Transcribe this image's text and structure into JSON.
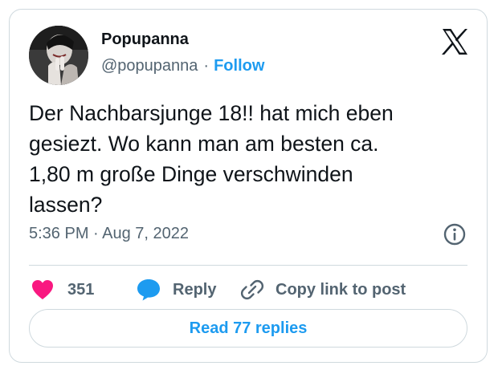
{
  "author": {
    "display_name": "Popupanna",
    "handle": "@popupanna",
    "separator": "·",
    "follow_label": "Follow"
  },
  "tweet": {
    "text": "Der Nachbarsjunge 18!! hat mich eben\ngesiezt. Wo kann man am besten ca.\n1,80 m große Dinge verschwinden\nlassen?",
    "timestamp": "5:36 PM · Aug 7, 2022"
  },
  "actions": {
    "like_count": "351",
    "reply_label": "Reply",
    "copy_link_label": "Copy link to post"
  },
  "read_replies_label": "Read 77 replies",
  "colors": {
    "accent": "#1d9bf0",
    "like": "#f91880",
    "text": "#0f1419",
    "secondary": "#536471",
    "border": "#cfd9de"
  },
  "icons": {
    "brand": "x-logo-icon",
    "info": "info-icon",
    "like": "heart-icon",
    "reply": "speech-bubble-icon",
    "copy_link": "link-icon"
  }
}
